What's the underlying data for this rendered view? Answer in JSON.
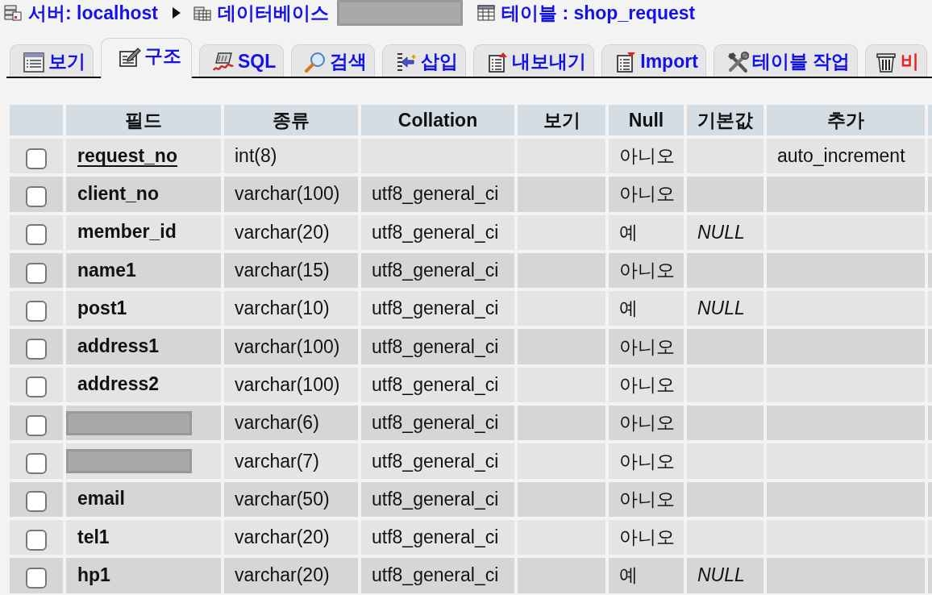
{
  "breadcrumb": [
    {
      "kind": "server",
      "label": "서버: localhost",
      "redacted": false,
      "arrow_after": true
    },
    {
      "kind": "database",
      "label": "데이터베이스",
      "redacted": true,
      "arrow_after": false
    },
    {
      "kind": "table",
      "label": "테이블 : shop_request",
      "redacted": false,
      "arrow_after": false
    }
  ],
  "tabs": [
    {
      "kind": "browse",
      "label": "보기",
      "selected": false
    },
    {
      "kind": "structure",
      "label": "구조",
      "selected": true
    },
    {
      "kind": "sql",
      "label": "SQL",
      "selected": false
    },
    {
      "kind": "search",
      "label": "검색",
      "selected": false
    },
    {
      "kind": "insert",
      "label": "삽입",
      "selected": false
    },
    {
      "kind": "export",
      "label": "내보내기",
      "selected": false
    },
    {
      "kind": "import",
      "label": "Import",
      "selected": false
    },
    {
      "kind": "operations",
      "label": "테이블 작업",
      "selected": false
    },
    {
      "kind": "empty",
      "label": "비",
      "selected": false
    }
  ],
  "table": {
    "columns": [
      "필드",
      "종류",
      "Collation",
      "보기",
      "Null",
      "기본값",
      "추가"
    ],
    "rows": [
      {
        "checked": false,
        "field": "request_no",
        "primary": true,
        "redacted": false,
        "type": "int(8)",
        "null": "아니오",
        "extra": "auto_increment"
      },
      {
        "checked": false,
        "field": "client_no",
        "primary": false,
        "redacted": false,
        "type": "varchar(100)",
        "collation": "utf8_general_ci",
        "null": "아니오"
      },
      {
        "checked": false,
        "field": "member_id",
        "primary": false,
        "redacted": false,
        "type": "varchar(20)",
        "collation": "utf8_general_ci",
        "null": "예",
        "default": "NULL"
      },
      {
        "checked": false,
        "field": "name1",
        "primary": false,
        "redacted": false,
        "type": "varchar(15)",
        "collation": "utf8_general_ci",
        "null": "아니오"
      },
      {
        "checked": false,
        "field": "post1",
        "primary": false,
        "redacted": false,
        "type": "varchar(10)",
        "collation": "utf8_general_ci",
        "null": "예",
        "default": "NULL"
      },
      {
        "checked": false,
        "field": "address1",
        "primary": false,
        "redacted": false,
        "type": "varchar(100)",
        "collation": "utf8_general_ci",
        "null": "아니오"
      },
      {
        "checked": false,
        "field": "address2",
        "primary": false,
        "redacted": false,
        "type": "varchar(100)",
        "collation": "utf8_general_ci",
        "null": "아니오"
      },
      {
        "checked": false,
        "redacted": true,
        "type": "varchar(6)",
        "collation": "utf8_general_ci",
        "null": "아니오"
      },
      {
        "checked": false,
        "redacted": true,
        "type": "varchar(7)",
        "collation": "utf8_general_ci",
        "null": "아니오"
      },
      {
        "checked": false,
        "field": "email",
        "primary": false,
        "redacted": false,
        "type": "varchar(50)",
        "collation": "utf8_general_ci",
        "null": "아니오"
      },
      {
        "checked": false,
        "field": "tel1",
        "primary": false,
        "redacted": false,
        "type": "varchar(20)",
        "collation": "utf8_general_ci",
        "null": "아니오"
      },
      {
        "checked": false,
        "field": "hp1",
        "primary": false,
        "redacted": false,
        "type": "varchar(20)",
        "collation": "utf8_general_ci",
        "null": "예",
        "default": "NULL"
      }
    ]
  }
}
